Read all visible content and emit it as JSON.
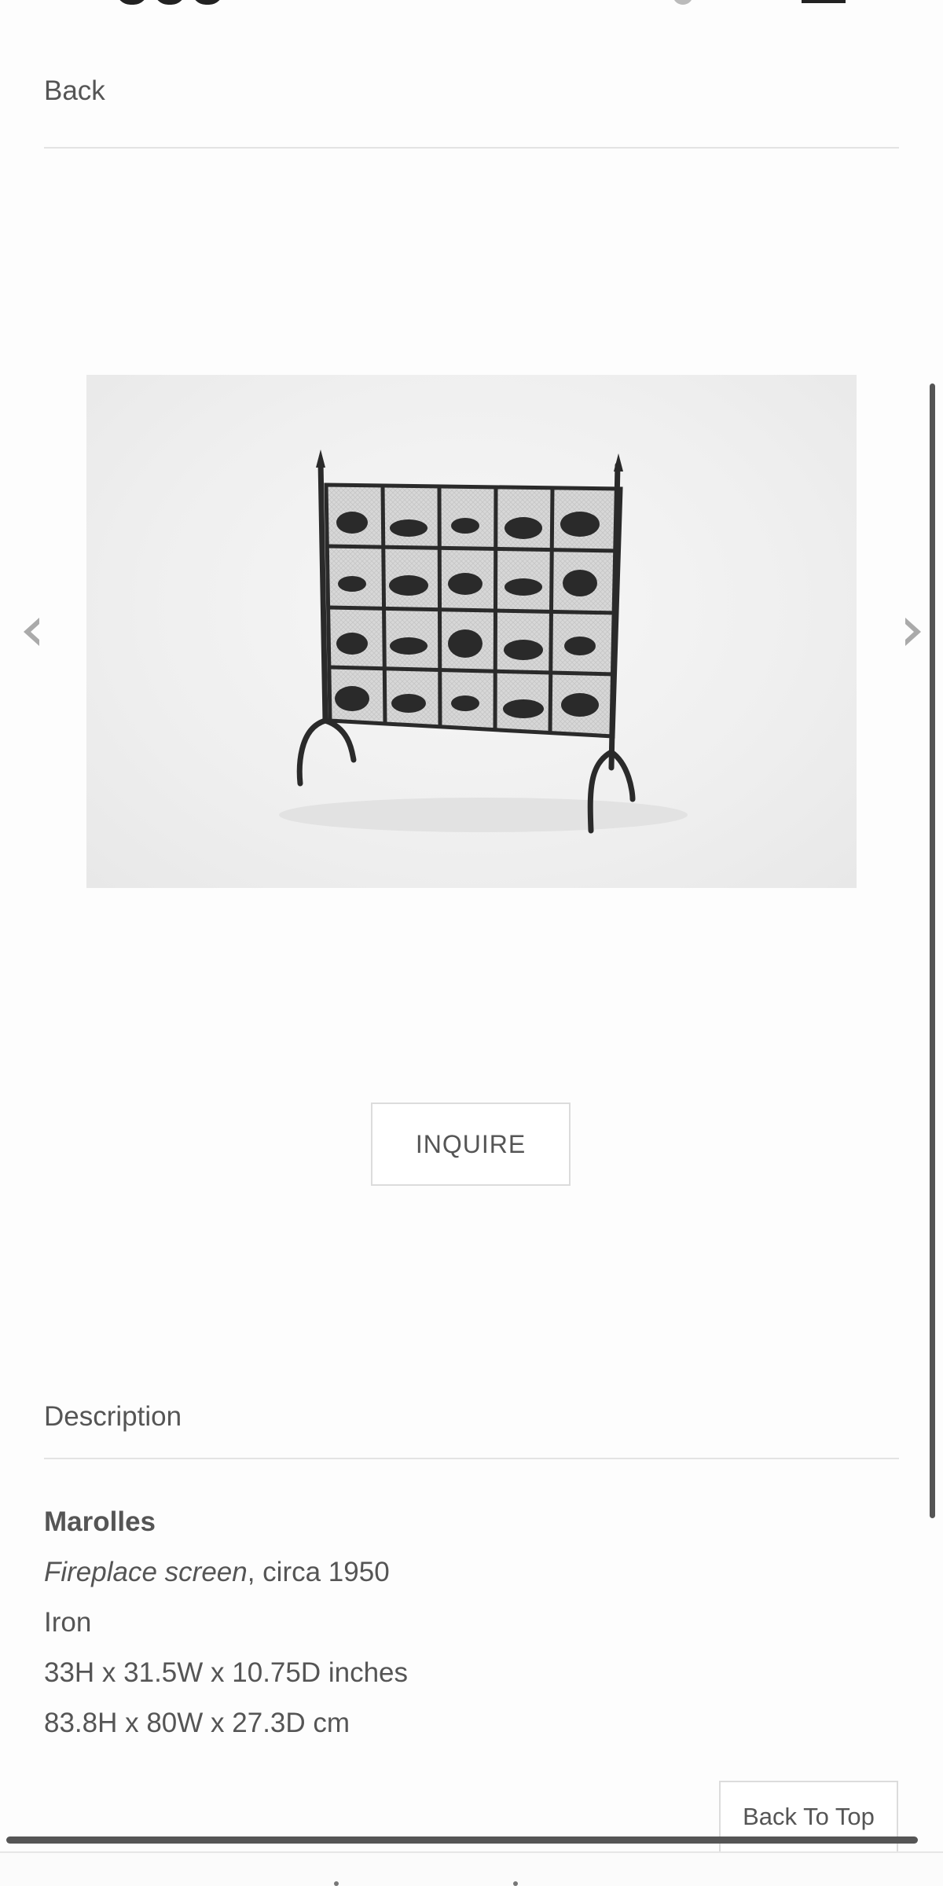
{
  "header": {
    "back_label": "Back"
  },
  "gallery": {
    "image_alt": "Fireplace screen, circa 1950",
    "prev_icon": "chevron-left-icon",
    "next_icon": "chevron-right-icon"
  },
  "actions": {
    "inquire_label": "INQUIRE"
  },
  "description": {
    "title": "Description",
    "artist": "Marolles",
    "work_title": "Fireplace screen",
    "work_date": ", circa 1950",
    "material": "Iron",
    "dimensions_in": "33H x 31.5W x 10.75D inches",
    "dimensions_cm": "83.8H x 80W x 27.3D cm"
  },
  "footer": {
    "back_to_top_label": "Back To Top"
  },
  "colors": {
    "text": "#555555",
    "border": "#dcdcdc",
    "arrow": "#aaaaaa",
    "iron": "#2a2a2a"
  }
}
